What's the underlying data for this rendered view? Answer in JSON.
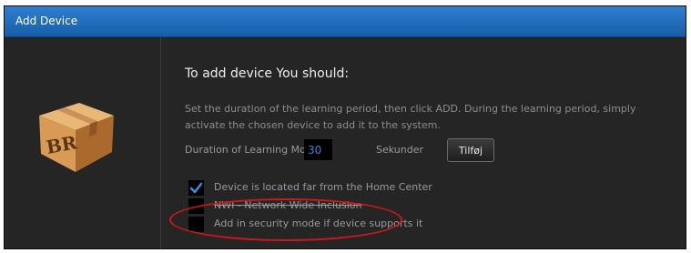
{
  "dialog": {
    "title": "Add Device"
  },
  "content": {
    "heading": "To add device You should:",
    "description": "Set the duration of the learning period, then click ADD. During the learning period, simply activate the chosen device to add it to the system.",
    "duration": {
      "label": "Duration of Learning Mode",
      "value": "30",
      "unit": "Sekunder",
      "add_button": "Tilføj"
    },
    "options": [
      {
        "label": "Device is located far from the Home Center",
        "checked": true
      },
      {
        "label": "NWI - Network Wide Inclusion",
        "checked": false
      },
      {
        "label": "Add in security mode if device supports it",
        "checked": false
      }
    ]
  },
  "colors": {
    "titlebar": "#1f6fbf",
    "background": "#252525",
    "checkmark": "#3b8fe0",
    "annotation": "#d11818"
  },
  "icons": {
    "device": "cardboard-box-icon",
    "checkbox_checked": "checkmark-icon"
  }
}
